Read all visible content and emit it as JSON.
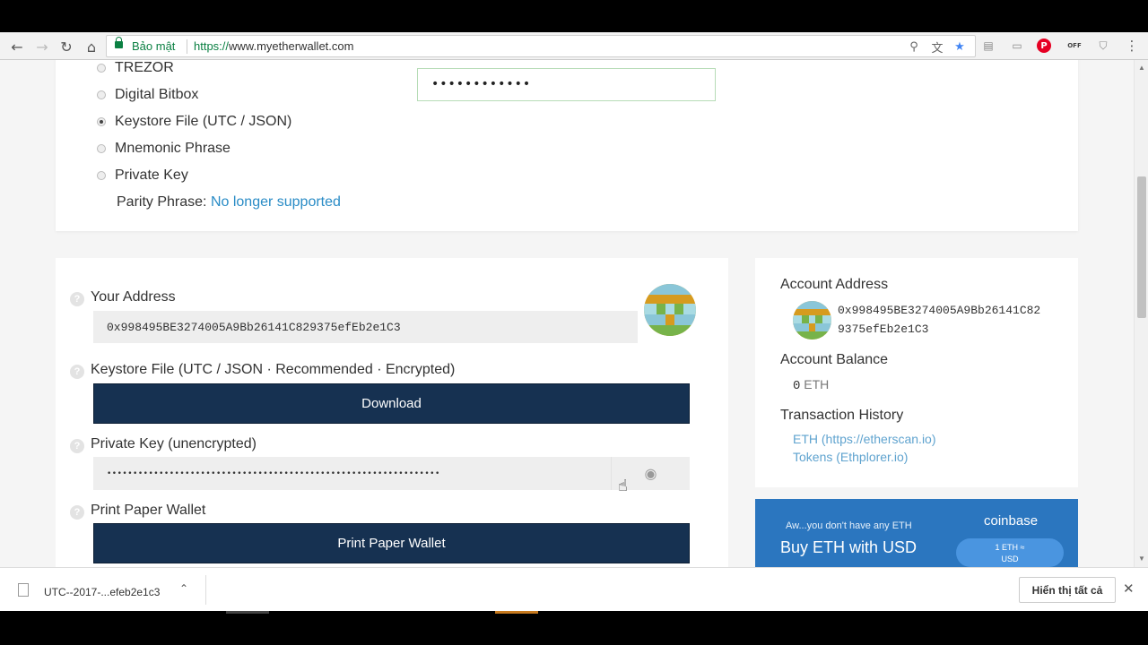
{
  "browser": {
    "secure_label": "Bảo mật",
    "url_scheme": "https://",
    "url_host": "www.myetherwallet.com",
    "nav": {
      "back": "←",
      "forward": "→",
      "reload": "↻",
      "home": "⌂"
    },
    "omni_icons": {
      "zoom": "⚲",
      "translate": "文",
      "star": "★"
    },
    "ext_icons": [
      "▤",
      "▭",
      "P",
      "OFF",
      "⛉",
      "⋮"
    ]
  },
  "access": {
    "options": [
      {
        "label": "TREZOR",
        "checked": false
      },
      {
        "label": "Digital Bitbox",
        "checked": false
      },
      {
        "label": "Keystore File (UTC / JSON)",
        "checked": true
      },
      {
        "label": "Mnemonic Phrase",
        "checked": false
      },
      {
        "label": "Private Key",
        "checked": false
      }
    ],
    "parity_label": "Parity Phrase:",
    "parity_link": "No longer supported",
    "password_value": "••••••••••••"
  },
  "wallet": {
    "address_label": "Your Address",
    "address_value": "0x998495BE3274005A9Bb26141C829375efEb2e1C3",
    "keystore_label": "Keystore File (UTC / JSON · Recommended · Encrypted)",
    "download_button": "Download",
    "privkey_label": "Private Key (unencrypted)",
    "privkey_value": "••••••••••••••••••••••••••••••••••••••••••••••••••••••••••••••••",
    "eye_icon": "◉",
    "print_label": "Print Paper Wallet",
    "print_button": "Print Paper Wallet",
    "help_glyph": "?"
  },
  "sidebar": {
    "account_address_title": "Account Address",
    "account_address_line1": "0x998495BE3274005A9Bb26141C82",
    "account_address_line2": "9375efEb2e1C3",
    "balance_title": "Account Balance",
    "balance_amount": "0",
    "balance_unit": "ETH",
    "history_title": "Transaction History",
    "history_links": [
      "ETH (https://etherscan.io)",
      "Tokens (Ethplorer.io)"
    ]
  },
  "coinbase": {
    "small_text": "Aw...you don't have any ETH",
    "big_text": "Buy ETH with USD",
    "logo": "coinbase",
    "pill_line1": "1 ETH ≈",
    "pill_line2": "USD"
  },
  "downloads": {
    "file_name": "UTC--2017-...efeb2e1c3",
    "caret": "⌃",
    "show_all": "Hiển thị tất cả",
    "close": "✕"
  },
  "colors": {
    "dark_button": "#163151",
    "link": "#2a8cc6",
    "coinbase_blue": "#2b76bf",
    "secure_green": "#0b8043"
  }
}
